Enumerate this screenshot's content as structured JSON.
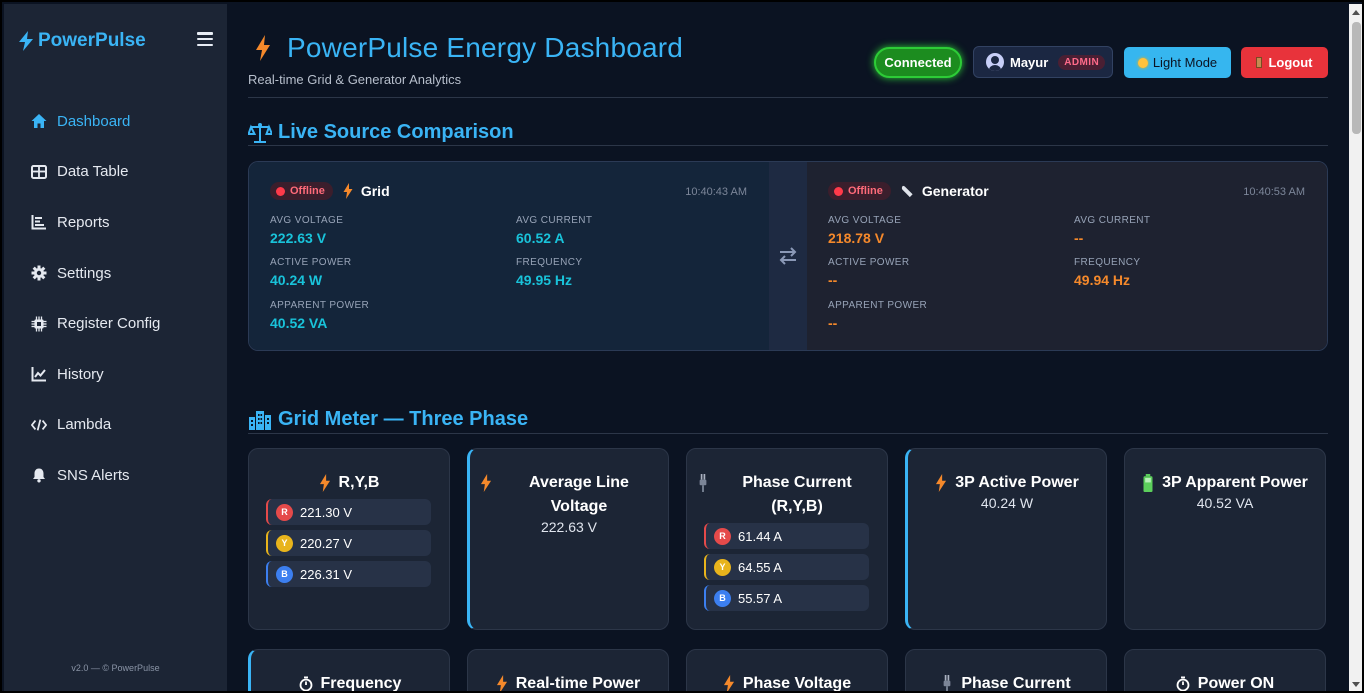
{
  "app": {
    "brand": "PowerPulse",
    "footer": "v2.0 — © PowerPulse"
  },
  "sidebar": {
    "items": [
      {
        "label": "Dashboard",
        "icon": "home-icon",
        "active": true
      },
      {
        "label": "Data Table",
        "icon": "table-icon"
      },
      {
        "label": "Reports",
        "icon": "reports-icon"
      },
      {
        "label": "Settings",
        "icon": "gear-icon"
      },
      {
        "label": "Register Config",
        "icon": "chip-icon"
      },
      {
        "label": "History",
        "icon": "line-chart-icon"
      },
      {
        "label": "Lambda",
        "icon": "code-icon"
      },
      {
        "label": "SNS Alerts",
        "icon": "bell-icon"
      }
    ]
  },
  "header": {
    "title": "PowerPulse Energy Dashboard",
    "subtitle": "Real-time Grid & Generator Analytics",
    "status": "Connected",
    "user": "Mayur",
    "role": "ADMIN",
    "theme_button": "Light Mode",
    "logout_button": "Logout"
  },
  "live": {
    "heading": "Live Source Comparison",
    "grid": {
      "status": "Offline",
      "name": "Grid",
      "time": "10:40:43 AM",
      "avg_voltage_label": "AVG VOLTAGE",
      "avg_voltage": "222.63 V",
      "avg_current_label": "AVG CURRENT",
      "avg_current": "60.52 A",
      "active_power_label": "ACTIVE POWER",
      "active_power": "40.24 W",
      "frequency_label": "FREQUENCY",
      "frequency": "49.95 Hz",
      "apparent_power_label": "APPARENT POWER",
      "apparent_power": "40.52 VA"
    },
    "generator": {
      "status": "Offline",
      "name": "Generator",
      "time": "10:40:53 AM",
      "avg_voltage_label": "AVG VOLTAGE",
      "avg_voltage": "218.78 V",
      "avg_current_label": "AVG CURRENT",
      "avg_current": "--",
      "active_power_label": "ACTIVE POWER",
      "active_power": "--",
      "frequency_label": "FREQUENCY",
      "frequency": "49.94 Hz",
      "apparent_power_label": "APPARENT POWER",
      "apparent_power": "--"
    }
  },
  "grid_meter": {
    "heading": "Grid Meter — Three Phase",
    "cards": {
      "ryb": {
        "title": "R,Y,B",
        "phases": [
          {
            "tag": "R",
            "value": "221.30 V"
          },
          {
            "tag": "Y",
            "value": "220.27 V"
          },
          {
            "tag": "B",
            "value": "226.31 V"
          }
        ]
      },
      "avg_line_voltage": {
        "title": "Average Line Voltage",
        "value": "222.63 V"
      },
      "phase_current": {
        "title": "Phase Current (R,Y,B)",
        "phases": [
          {
            "tag": "R",
            "value": "61.44 A"
          },
          {
            "tag": "Y",
            "value": "64.55 A"
          },
          {
            "tag": "B",
            "value": "55.57 A"
          }
        ]
      },
      "active_power": {
        "title": "3P Active Power",
        "value": "40.24 W"
      },
      "apparent_power": {
        "title": "3P Apparent Power",
        "value": "40.52 VA"
      }
    },
    "row2": [
      {
        "title": "Frequency"
      },
      {
        "title": "Real-time Power"
      },
      {
        "title": "Phase Voltage"
      },
      {
        "title": "Phase Current"
      },
      {
        "title": "Power ON"
      }
    ]
  },
  "colors": {
    "accent": "#3ab4f5",
    "grid_value": "#19c3da",
    "generator_value": "#f5892b",
    "connected": "#1c8c1f",
    "logout": "#e8333b",
    "offline": "#ff3a4a"
  }
}
